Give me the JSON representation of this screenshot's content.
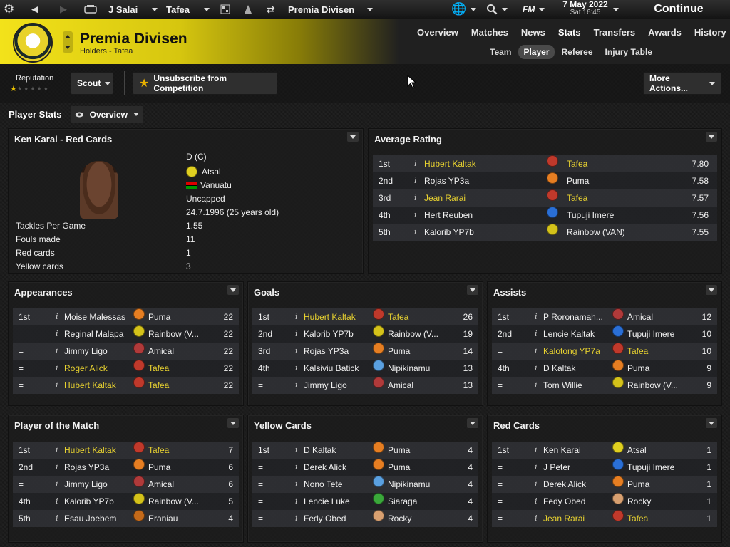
{
  "topbar": {
    "manager": "J Salai",
    "club": "Tafea",
    "competition": "Premia Divisen",
    "fm_label": "FM",
    "date_main": "7 May 2022",
    "date_sub": "Sat 16:45",
    "continue": "Continue"
  },
  "header": {
    "title": "Premia Divisen",
    "subtitle": "Holders - Tafea",
    "nav": [
      "Overview",
      "Matches",
      "News",
      "Stats",
      "Transfers",
      "Awards",
      "History"
    ],
    "subnav": [
      "Team",
      "Player",
      "Referee",
      "Injury Table"
    ]
  },
  "toolbar": {
    "reputation": "Reputation",
    "scout": "Scout",
    "unsubscribe": "Unsubscribe from Competition",
    "more_actions": "More Actions..."
  },
  "player_stats": {
    "title": "Player Stats",
    "view": "Overview"
  },
  "profile": {
    "title": "Ken Karai - Red Cards",
    "position": "D (C)",
    "club": "Atsal",
    "nation": "Vanuatu",
    "caps": "Uncapped",
    "dob": "24.7.1996 (25 years old)",
    "stats": [
      {
        "label": "Tackles Per Game",
        "value": "1.55"
      },
      {
        "label": "Fouls made",
        "value": "11"
      },
      {
        "label": "Red cards",
        "value": "1"
      },
      {
        "label": "Yellow cards",
        "value": "3"
      }
    ]
  },
  "avg_rating": {
    "title": "Average Rating",
    "rows": [
      {
        "pos": "1st",
        "name": "Hubert Kaltak",
        "hl": true,
        "club": "Tafea",
        "club_hl": true,
        "val": "7.80",
        "crest": "#c0392b"
      },
      {
        "pos": "2nd",
        "name": "Rojas YP3a",
        "hl": false,
        "club": "Puma",
        "club_hl": false,
        "val": "7.58",
        "crest": "#e67e22"
      },
      {
        "pos": "3rd",
        "name": "Jean Rarai",
        "hl": true,
        "club": "Tafea",
        "club_hl": true,
        "val": "7.57",
        "crest": "#c0392b"
      },
      {
        "pos": "4th",
        "name": "Hert Reuben",
        "hl": false,
        "club": "Tupuji Imere",
        "club_hl": false,
        "val": "7.56",
        "crest": "#2a6fd6"
      },
      {
        "pos": "5th",
        "name": "Kalorib YP7b",
        "hl": false,
        "club": "Rainbow (VAN)",
        "club_hl": false,
        "val": "7.55",
        "crest": "#d4c21a"
      }
    ]
  },
  "appearances": {
    "title": "Appearances",
    "rows": [
      {
        "pos": "1st",
        "name": "Moise Malessas",
        "hl": false,
        "club": "Puma",
        "club_hl": false,
        "val": "22",
        "crest": "#e67e22"
      },
      {
        "pos": "=",
        "name": "Reginal Malapa",
        "hl": false,
        "club": "Rainbow (V...",
        "club_hl": false,
        "val": "22",
        "crest": "#d4c21a"
      },
      {
        "pos": "=",
        "name": "Jimmy Ligo",
        "hl": false,
        "club": "Amical",
        "club_hl": false,
        "val": "22",
        "crest": "#b03a3a"
      },
      {
        "pos": "=",
        "name": "Roger Alick",
        "hl": true,
        "club": "Tafea",
        "club_hl": true,
        "val": "22",
        "crest": "#c0392b"
      },
      {
        "pos": "=",
        "name": "Hubert Kaltak",
        "hl": true,
        "club": "Tafea",
        "club_hl": true,
        "val": "22",
        "crest": "#c0392b"
      }
    ]
  },
  "goals": {
    "title": "Goals",
    "rows": [
      {
        "pos": "1st",
        "name": "Hubert Kaltak",
        "hl": true,
        "club": "Tafea",
        "club_hl": true,
        "val": "26",
        "crest": "#c0392b"
      },
      {
        "pos": "2nd",
        "name": "Kalorib YP7b",
        "hl": false,
        "club": "Rainbow (V...",
        "club_hl": false,
        "val": "19",
        "crest": "#d4c21a"
      },
      {
        "pos": "3rd",
        "name": "Rojas YP3a",
        "hl": false,
        "club": "Puma",
        "club_hl": false,
        "val": "14",
        "crest": "#e67e22"
      },
      {
        "pos": "4th",
        "name": "Kalsiviu Batick",
        "hl": false,
        "club": "Nipikinamu",
        "club_hl": false,
        "val": "13",
        "crest": "#5aa0e0"
      },
      {
        "pos": "=",
        "name": "Jimmy Ligo",
        "hl": false,
        "club": "Amical",
        "club_hl": false,
        "val": "13",
        "crest": "#b03a3a"
      }
    ]
  },
  "assists": {
    "title": "Assists",
    "rows": [
      {
        "pos": "1st",
        "name": "P Roronamah...",
        "hl": false,
        "club": "Amical",
        "club_hl": false,
        "val": "12",
        "crest": "#b03a3a"
      },
      {
        "pos": "2nd",
        "name": "Lencie Kaltak",
        "hl": false,
        "club": "Tupuji Imere",
        "club_hl": false,
        "val": "10",
        "crest": "#2a6fd6"
      },
      {
        "pos": "=",
        "name": "Kalotong YP7a",
        "hl": true,
        "club": "Tafea",
        "club_hl": true,
        "val": "10",
        "crest": "#c0392b"
      },
      {
        "pos": "4th",
        "name": "D Kaltak",
        "hl": false,
        "club": "Puma",
        "club_hl": false,
        "val": "9",
        "crest": "#e67e22"
      },
      {
        "pos": "=",
        "name": "Tom Willie",
        "hl": false,
        "club": "Rainbow (V...",
        "club_hl": false,
        "val": "9",
        "crest": "#d4c21a"
      }
    ]
  },
  "potm": {
    "title": "Player of the Match",
    "rows": [
      {
        "pos": "1st",
        "name": "Hubert Kaltak",
        "hl": true,
        "club": "Tafea",
        "club_hl": true,
        "val": "7",
        "crest": "#c0392b"
      },
      {
        "pos": "2nd",
        "name": "Rojas YP3a",
        "hl": false,
        "club": "Puma",
        "club_hl": false,
        "val": "6",
        "crest": "#e67e22"
      },
      {
        "pos": "=",
        "name": "Jimmy Ligo",
        "hl": false,
        "club": "Amical",
        "club_hl": false,
        "val": "6",
        "crest": "#b03a3a"
      },
      {
        "pos": "4th",
        "name": "Kalorib YP7b",
        "hl": false,
        "club": "Rainbow (V...",
        "club_hl": false,
        "val": "5",
        "crest": "#d4c21a"
      },
      {
        "pos": "5th",
        "name": "Esau Joebem",
        "hl": false,
        "club": "Eraniau",
        "club_hl": false,
        "val": "4",
        "crest": "#c46a1a"
      }
    ]
  },
  "yellow_cards": {
    "title": "Yellow Cards",
    "rows": [
      {
        "pos": "1st",
        "name": "D Kaltak",
        "hl": false,
        "club": "Puma",
        "club_hl": false,
        "val": "4",
        "crest": "#e67e22"
      },
      {
        "pos": "=",
        "name": "Derek Alick",
        "hl": false,
        "club": "Puma",
        "club_hl": false,
        "val": "4",
        "crest": "#e67e22"
      },
      {
        "pos": "=",
        "name": "Nono Tete",
        "hl": false,
        "club": "Nipikinamu",
        "club_hl": false,
        "val": "4",
        "crest": "#5aa0e0"
      },
      {
        "pos": "=",
        "name": "Lencie Luke",
        "hl": false,
        "club": "Siaraga",
        "club_hl": false,
        "val": "4",
        "crest": "#3aa83a"
      },
      {
        "pos": "=",
        "name": "Fedy Obed",
        "hl": false,
        "club": "Rocky",
        "club_hl": false,
        "val": "4",
        "crest": "#d8a070"
      }
    ]
  },
  "red_cards": {
    "title": "Red Cards",
    "rows": [
      {
        "pos": "1st",
        "name": "Ken Karai",
        "hl": false,
        "club": "Atsal",
        "club_hl": false,
        "val": "1",
        "crest": "#e0d020"
      },
      {
        "pos": "=",
        "name": "J Peter",
        "hl": false,
        "club": "Tupuji Imere",
        "club_hl": false,
        "val": "1",
        "crest": "#2a6fd6"
      },
      {
        "pos": "=",
        "name": "Derek Alick",
        "hl": false,
        "club": "Puma",
        "club_hl": false,
        "val": "1",
        "crest": "#e67e22"
      },
      {
        "pos": "=",
        "name": "Fedy Obed",
        "hl": false,
        "club": "Rocky",
        "club_hl": false,
        "val": "1",
        "crest": "#d8a070"
      },
      {
        "pos": "=",
        "name": "Jean Rarai",
        "hl": true,
        "club": "Tafea",
        "club_hl": true,
        "val": "1",
        "crest": "#c0392b"
      }
    ]
  }
}
